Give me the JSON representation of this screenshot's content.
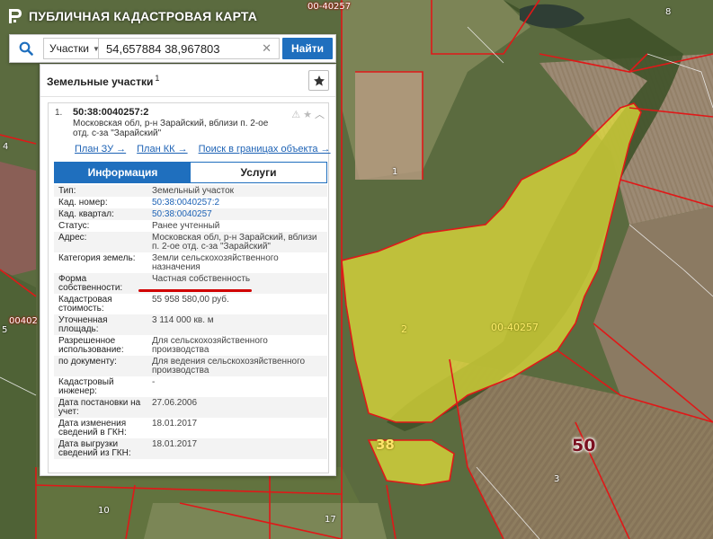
{
  "header": {
    "title": "ПУБЛИЧНАЯ КАДАСТРОВАЯ КАРТА"
  },
  "search": {
    "type_label": "Участки",
    "query": "54,657884 38,967803",
    "find_label": "Найти"
  },
  "panel": {
    "title": "Земельные участки",
    "count": "1",
    "card": {
      "index": "1.",
      "cadastral_number": "50:38:0040257:2",
      "address": "Московская обл, р-н Зарайский, вблизи п. 2-ое отд. с-за \"Зарайский\"",
      "links": [
        "План ЗУ →",
        "План КК →",
        "Поиск в границах объекта →"
      ],
      "tabs": {
        "info": "Информация",
        "services": "Услуги"
      },
      "attributes": [
        {
          "k": "Тип:",
          "v": "Земельный участок"
        },
        {
          "k": "Кад. номер:",
          "v": "50:38:0040257:2",
          "link": true
        },
        {
          "k": "Кад. квартал:",
          "v": "50:38:0040257",
          "link": true
        },
        {
          "k": "Статус:",
          "v": "Ранее учтенный"
        },
        {
          "k": "Адрес:",
          "v": "Московская обл, р-н Зарайский, вблизи п. 2-ое отд. с-за \"Зарайский\""
        },
        {
          "k": "Категория земель:",
          "v": "Земли сельскохозяйственного назначения"
        },
        {
          "k": "Форма собственности:",
          "v": "Частная собственность",
          "highlight": true
        },
        {
          "k": "Кадастровая стоимость:",
          "v": "55 958 580,00 руб."
        },
        {
          "k": "Уточненная площадь:",
          "v": "3 114 000 кв. м"
        },
        {
          "k": "Разрешенное использование:",
          "v": "Для сельскохозяйственного производства"
        },
        {
          "k": "по документу:",
          "v": "Для ведения сельскохозяйственного производства"
        },
        {
          "k": "Кадастровый инженер:",
          "v": "-"
        },
        {
          "k": "Дата постановки на учет:",
          "v": "27.06.2006"
        },
        {
          "k": "Дата изменения сведений в ГКН:",
          "v": "18.01.2017"
        },
        {
          "k": "Дата выгрузки сведений из ГКН:",
          "v": "18.01.2017"
        }
      ]
    }
  },
  "map": {
    "labels": [
      "00-40257",
      "8",
      "4",
      "1",
      "2",
      "00-40257",
      "38",
      "50",
      "3",
      "5",
      "00402",
      "10",
      "17"
    ]
  },
  "colors": {
    "accent": "#1f6fbe",
    "highlight_underline": "#d10000",
    "parcel_fill": "#e6e23a",
    "boundary": "#e01818"
  }
}
